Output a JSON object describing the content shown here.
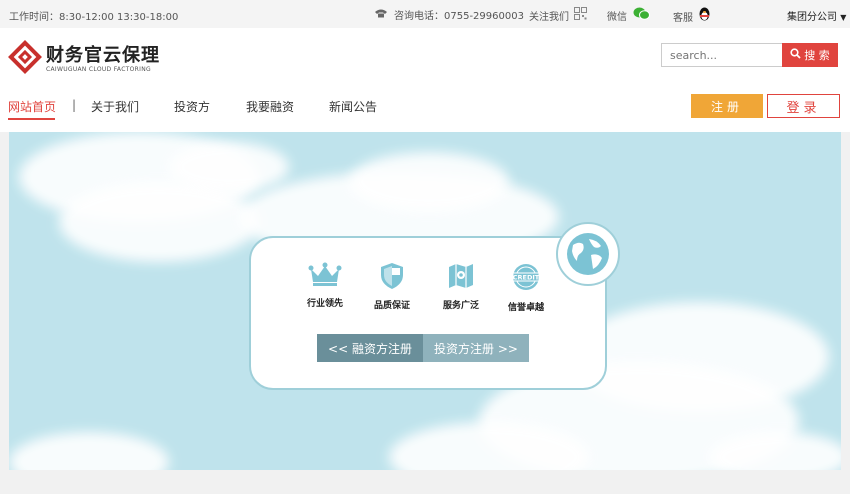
{
  "topbar": {
    "hours": "工作时间：8:30-12:00   13:30-18:00",
    "phone": "咨询电话：0755-29960003",
    "follow": "关注我们",
    "wechat": "微信",
    "service": "客服",
    "group": "集团分公司"
  },
  "logo": {
    "name": "财务官云保理",
    "sub": "CAIWUGUAN CLOUD FACTORING"
  },
  "search": {
    "placeholder": "search...",
    "button": "搜 索"
  },
  "nav": [
    "网站首页",
    "关于我们",
    "投资方",
    "我要融资",
    "新闻公告"
  ],
  "nav_separator": "|",
  "auth": {
    "register": "注册",
    "login": "登录"
  },
  "features": [
    "行业领先",
    "品质保证",
    "服务广泛",
    "信誉卓越"
  ],
  "register_buttons": {
    "financier": "<< 融资方注册",
    "investor": "投资方注册 >>"
  },
  "colors": {
    "accent": "#e0443e",
    "register": "#f0a637",
    "banner": "#bfe3ec",
    "icon": "#7cc3d4"
  }
}
